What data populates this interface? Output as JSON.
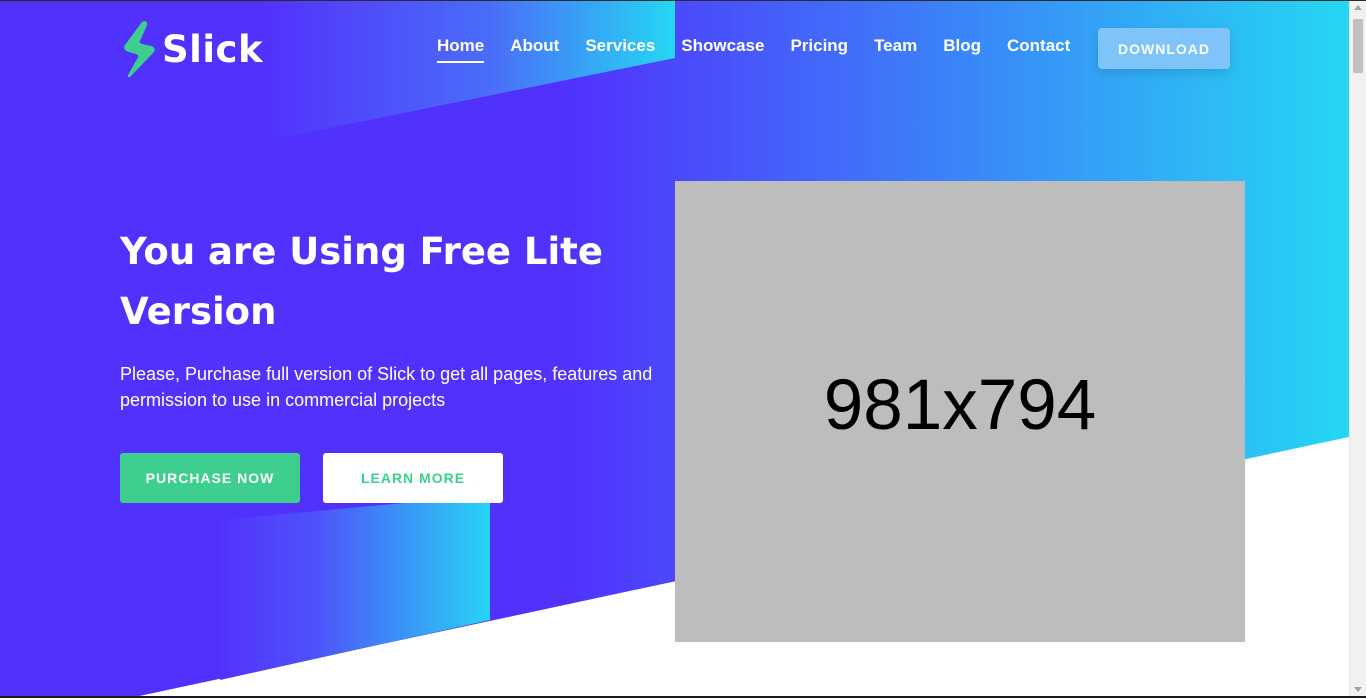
{
  "brand": {
    "name": "Slick",
    "icon": "lightning-logo-icon",
    "icon_color": "#3ecf8e"
  },
  "nav": {
    "items": [
      {
        "label": "Home",
        "active": true
      },
      {
        "label": "About"
      },
      {
        "label": "Services"
      },
      {
        "label": "Showcase"
      },
      {
        "label": "Pricing"
      },
      {
        "label": "Team"
      },
      {
        "label": "Blog"
      },
      {
        "label": "Contact"
      }
    ],
    "download_label": "DOWNLOAD"
  },
  "hero": {
    "title": "You are Using Free Lite Version",
    "text": "Please, Purchase full version of Slick to get all pages, features and permission to use in commercial projects",
    "primary_button": "PURCHASE NOW",
    "secondary_button": "LEARN MORE",
    "image_placeholder": "981x794"
  },
  "colors": {
    "hero_purple": "#5132fd",
    "hero_cyan": "#25d7f3",
    "accent_green": "#3ecf8e",
    "download_button": "#7ec4f9",
    "placeholder_gray": "#bdbdbd"
  }
}
